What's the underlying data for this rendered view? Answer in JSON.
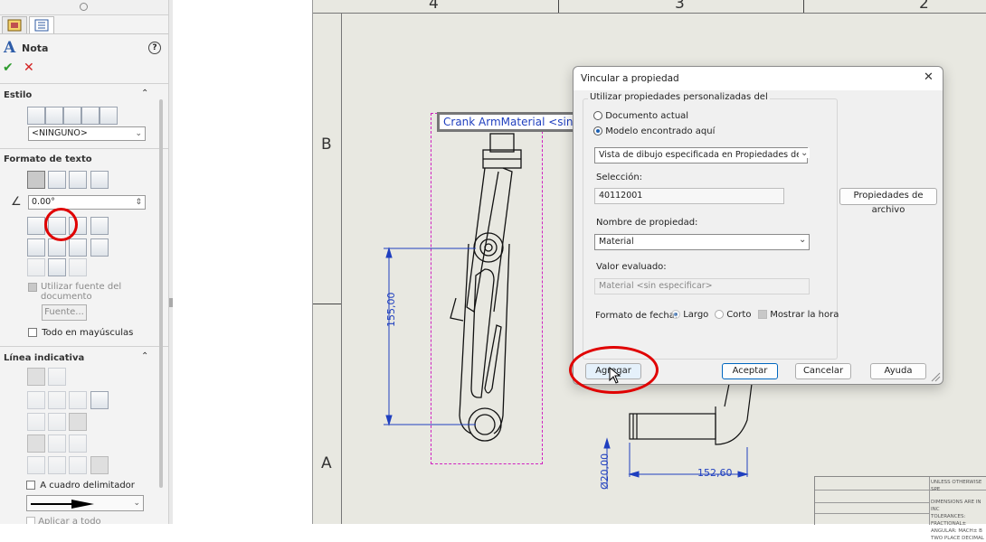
{
  "pm": {
    "title": "Nota",
    "help_symbol": "?",
    "accept_symbol": "✔",
    "cancel_symbol": "✕",
    "sections": {
      "estilo": {
        "title": "Estilo",
        "style_combo": "<NINGUNO>"
      },
      "formato": {
        "title": "Formato de texto",
        "angle_value": "0.00°",
        "use_doc_font_line1": "Utilizar fuente del",
        "use_doc_font_line2": "documento",
        "font_button": "Fuente...",
        "all_caps": "Todo en mayúsculas"
      },
      "linea": {
        "title": "Línea indicativa",
        "border_check": "A cuadro delimitador",
        "apply_all": "Aplicar a todo"
      }
    },
    "collapse_symbol": "⌃"
  },
  "sheet": {
    "zones_top": [
      "4",
      "3",
      "2"
    ],
    "zones_left": [
      "B",
      "A"
    ],
    "note_text": "Crank ArmMaterial <sin e",
    "dim_vertical": "155,00",
    "dim_horizontal": "152,60",
    "dim_diameter": "Ø20,00",
    "titleblock_lines": [
      "UNLESS OTHERWISE SPE",
      "DIMENSIONS ARE IN INC",
      "TOLERANCES:",
      "FRACTIONAL±",
      "ANGULAR: MACH±  B",
      "TWO PLACE DECIMAL"
    ]
  },
  "dialog": {
    "title": "Vincular a propiedad",
    "close_symbol": "✕",
    "group_title": "Utilizar propiedades personalizadas del",
    "radio_current": "Documento actual",
    "radio_model": "Modelo encontrado aquí",
    "view_combo": "Vista de dibujo especificada en Propiedades de hoja",
    "selection_label": "Selección:",
    "selection_value": "40112001",
    "file_props_button": "Propiedades de archivo",
    "prop_name_label": "Nombre de propiedad:",
    "prop_name_value": "Material",
    "evaluated_label": "Valor evaluado:",
    "evaluated_value": "Material <sin especificar>",
    "date_format_label": "Formato de fecha:",
    "date_long": "Largo",
    "date_short": "Corto",
    "show_time": "Mostrar la hora",
    "buttons": {
      "add": "Agregar",
      "ok": "Aceptar",
      "cancel": "Cancelar",
      "help": "Ayuda"
    }
  },
  "colors": {
    "accent": "#0067c0",
    "annotation_red": "#e00000",
    "dimension_blue": "#1f3fbf",
    "note_magenta": "#d020c0",
    "sheet_bg": "#e8e8e1"
  }
}
